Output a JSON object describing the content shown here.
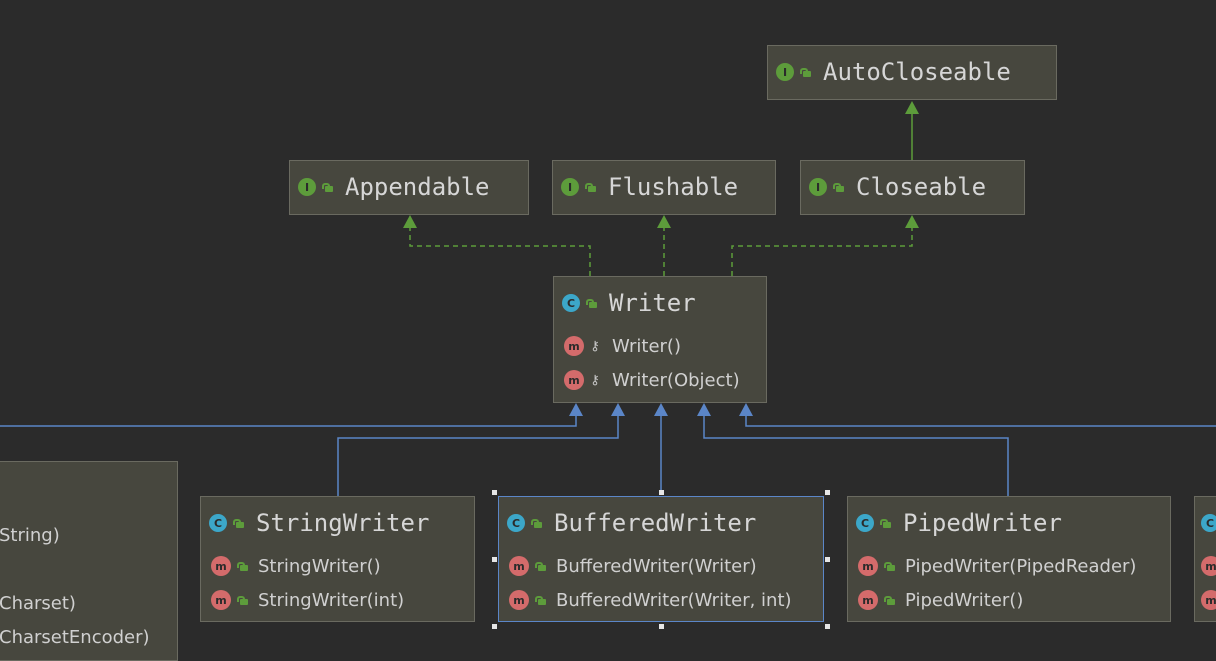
{
  "diagram": {
    "interfaces": {
      "autocloseable": "AutoCloseable",
      "appendable": "Appendable",
      "flushable": "Flushable",
      "closeable": "Closeable"
    },
    "writer": {
      "name": "Writer",
      "members": [
        "Writer()",
        "Writer(Object)"
      ]
    },
    "string_writer": {
      "name": "StringWriter",
      "members": [
        "StringWriter()",
        "StringWriter(int)"
      ]
    },
    "buffered_writer": {
      "name": "BufferedWriter",
      "members": [
        "BufferedWriter(Writer)",
        "BufferedWriter(Writer, int)"
      ]
    },
    "piped_writer": {
      "name": "PipedWriter",
      "members": [
        "PipedWriter(PipedReader)",
        "PipedWriter()"
      ]
    },
    "partial_left_members": [
      "String)",
      "Charset)",
      "CharsetEncoder)"
    ],
    "badges": {
      "interface": "I",
      "class": "C",
      "method": "m"
    },
    "colors": {
      "background": "#2b2b2b",
      "node_fill": "#47473e",
      "implements_edge": "#5d9c3b",
      "extends_edge": "#5b86c8",
      "interface_badge": "#5d9c3b",
      "class_badge": "#3ca7c9",
      "method_badge": "#d46b6b"
    }
  }
}
